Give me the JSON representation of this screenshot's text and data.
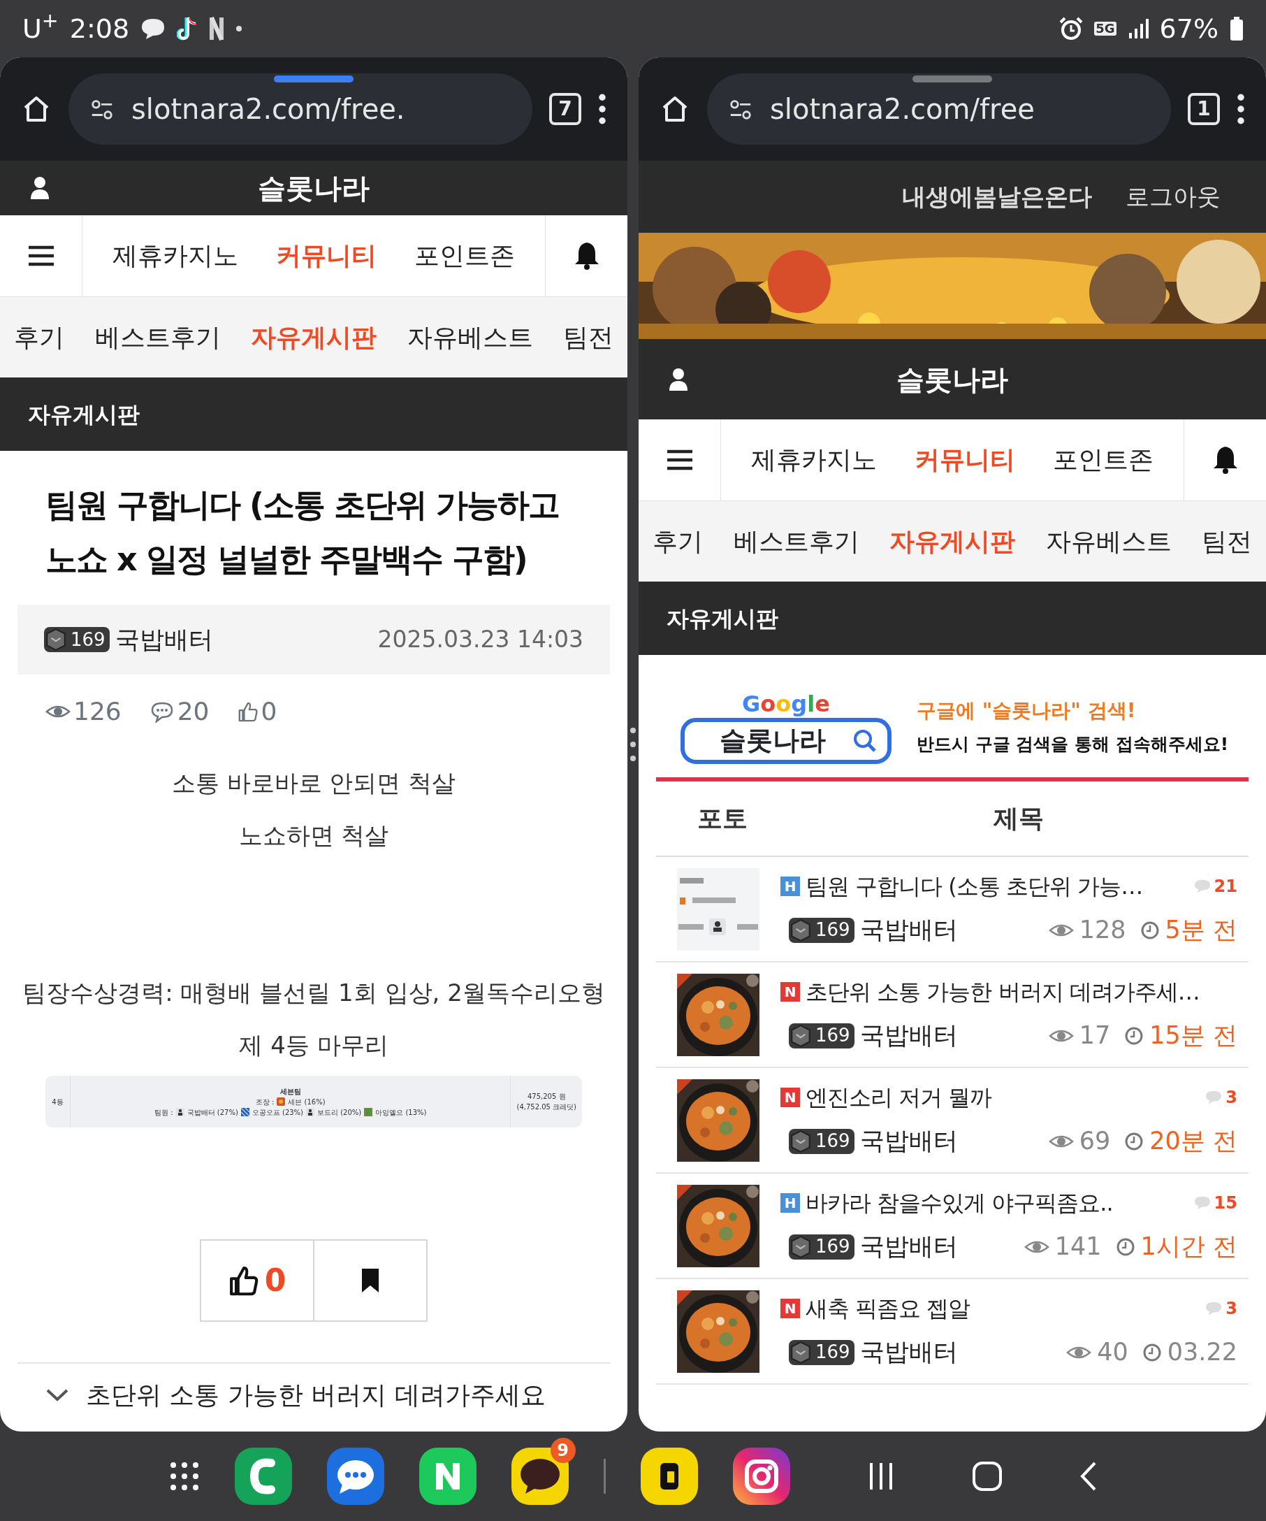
{
  "status_bar": {
    "carrier": "U$^{+}$",
    "time": "2:08",
    "network": "5G",
    "battery": "67%"
  },
  "windows": [
    {
      "kind": "post",
      "browser": {
        "active": true,
        "url": "slotnara2.com/free.",
        "tabs": "7"
      },
      "site": {
        "title": "슬롯나라",
        "nav": [
          {
            "label": "제휴카지노",
            "selected": false
          },
          {
            "label": "커뮤니티",
            "selected": true
          },
          {
            "label": "포인트존",
            "selected": false
          }
        ],
        "subnav": [
          {
            "label": "후기",
            "selected": false
          },
          {
            "label": "베스트후기",
            "selected": false
          },
          {
            "label": "자유게시판",
            "selected": true
          },
          {
            "label": "자유베스트",
            "selected": false
          },
          {
            "label": "팀전",
            "selected": false
          }
        ],
        "board": "자유게시판"
      },
      "post": {
        "title": "팀원 구합니다 (소통 초단위 가능하고 노쇼 x 일정 널널한 주말백수 구함)",
        "level": "169",
        "author": "국밥배터",
        "date": "2025.03.23 14:03",
        "views": "126",
        "comments": "20",
        "likes": "0",
        "paragraphs": [
          [
            "소통 바로바로 안되면 척살",
            "노쇼하면 척살"
          ],
          [
            "팀장수상경력: 매형배 블선릴 1회 입상, 2월독수리오형",
            "제 4등 마무리"
          ]
        ],
        "result": {
          "rank": "4등",
          "team": "세븐팀",
          "leader_label": "조장 :",
          "leader": "세븐 (16%)",
          "members_label": "팀원 :",
          "members": [
            "국밥배터 (27%)",
            "오공오프 (23%)",
            "보드리 (20%)",
            "아잉옐으 (13%)"
          ],
          "prize": "475,205 원",
          "credits": "(4,752.05 크레딧)"
        },
        "like_count": "0"
      },
      "next_post": "초단위 소통 가능한 버러지 데려가주세요"
    },
    {
      "kind": "list",
      "browser": {
        "active": false,
        "url": "slotnara2.com/free",
        "tabs": "1"
      },
      "account": {
        "nickname": "내생에봄날은온다",
        "logout": "로그아웃"
      },
      "banner": {
        "kind": "picture"
      },
      "site": {
        "title": "슬롯나라",
        "nav": [
          {
            "label": "제휴카지노",
            "selected": false
          },
          {
            "label": "커뮤니티",
            "selected": true
          },
          {
            "label": "포인트존",
            "selected": false
          }
        ],
        "subnav": [
          {
            "label": "후기",
            "selected": false
          },
          {
            "label": "베스트후기",
            "selected": false
          },
          {
            "label": "자유게시판",
            "selected": true
          },
          {
            "label": "자유베스트",
            "selected": false
          },
          {
            "label": "팀전",
            "selected": false
          }
        ],
        "board": "자유게시판"
      },
      "ad": {
        "logo": "Google",
        "query": "슬롯나라",
        "headline": "구글에 \"슬롯나라\" 검색!",
        "subline": "반드시 구글 검색을 통해 접속해주세요!"
      },
      "columns": [
        "포토",
        "제목"
      ],
      "rows": [
        {
          "photo": {
            "kind": "picture"
          },
          "kind": "hot",
          "badge": "H",
          "title": "팀원 구합니다 (소통 초단위 가능…",
          "comments": "21",
          "level": "169",
          "author": "국밥배터",
          "views": "128",
          "time": "5분 전",
          "recent": true
        },
        {
          "photo": {
            "kind": "picture"
          },
          "kind": "new",
          "badge": "N",
          "title": "초단위 소통 가능한 버러지 데려가주세…",
          "level": "169",
          "author": "국밥배터",
          "views": "17",
          "time": "15분 전",
          "recent": true
        },
        {
          "photo": {
            "kind": "picture"
          },
          "kind": "new",
          "badge": "N",
          "title": "엔진소리 저거 뭘까",
          "comments": "3",
          "level": "169",
          "author": "국밥배터",
          "views": "69",
          "time": "20분 전",
          "recent": true
        },
        {
          "photo": {
            "kind": "picture"
          },
          "kind": "hot",
          "badge": "H",
          "title": "바카라 참을수있게 야구픽좀요..",
          "comments": "15",
          "level": "169",
          "author": "국밥배터",
          "views": "141",
          "time": "1시간 전",
          "recent": true
        },
        {
          "photo": {
            "kind": "picture"
          },
          "kind": "new",
          "badge": "N",
          "title": "새축 픽좀요 젭알",
          "comments": "3",
          "level": "169",
          "author": "국밥배터",
          "views": "40",
          "time": "03.22",
          "recent": false
        }
      ]
    }
  ],
  "dock": {
    "badge": "9"
  }
}
